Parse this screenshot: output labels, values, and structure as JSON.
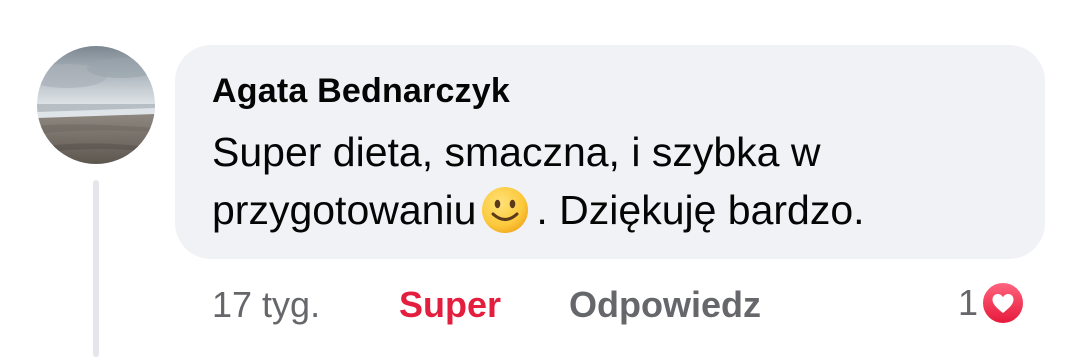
{
  "comment": {
    "author": "Agata Bednarczyk",
    "text_line1": "Super dieta, smaczna, i szybka w",
    "text_line2_before_emoji": "przygotowaniu",
    "emoji": "smiling-face-emoji",
    "text_line2_after_emoji": ". Dziękuję bardzo.",
    "timestamp": "17 tyg.",
    "like_label": "Super",
    "reply_label": "Odpowiedz",
    "reaction_count": "1",
    "reaction_icon": "heart-icon"
  },
  "colors": {
    "bubble_bg": "#f0f2f5",
    "text": "#050505",
    "secondary_text": "#65676b",
    "like_active": "#e41e3f",
    "heart": "#f33e58"
  }
}
